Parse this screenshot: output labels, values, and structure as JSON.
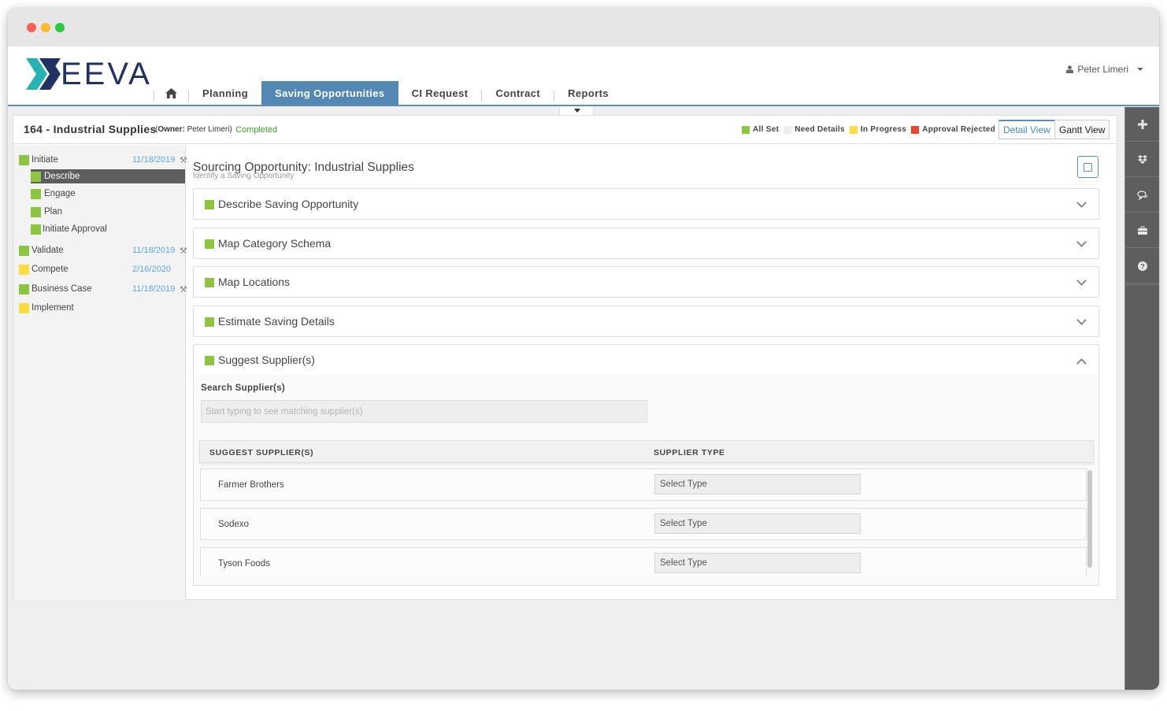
{
  "window": {
    "traffic_lights": [
      "close",
      "minimize",
      "maximize"
    ]
  },
  "brand": {
    "logo_text": "EEVA",
    "logo_mark": "X",
    "name": "XEEVA"
  },
  "nav": {
    "home_icon": "home-icon",
    "items": [
      {
        "label": "Planning",
        "active": false
      },
      {
        "label": "Saving Opportunities",
        "active": true
      },
      {
        "label": "CI Request",
        "active": false
      },
      {
        "label": "Contract",
        "active": false
      },
      {
        "label": "Reports",
        "active": false
      }
    ]
  },
  "user": {
    "name": "Peter Limeri",
    "icon": "user-icon"
  },
  "project": {
    "title": "164 - Industrial Supplies",
    "owner_label": "Owner:",
    "owner_name": "Peter Limeri",
    "status": "Completed"
  },
  "legend": [
    {
      "label": "All Set",
      "color": "#8cc63f"
    },
    {
      "label": "Need Details",
      "color": "#eeeeee"
    },
    {
      "label": "In Progress",
      "color": "#fddc3f"
    },
    {
      "label": "Approval Rejected",
      "color": "#f0452d"
    }
  ],
  "views": {
    "detail": "Detail View",
    "gantt": "Gantt View",
    "active": "Detail View"
  },
  "sidebar": {
    "steps": [
      {
        "label": "Initiate",
        "date": "11/18/2019",
        "status_color": "#8cc63f",
        "has_hammer": true,
        "substeps": [
          {
            "label": "Describe",
            "status_color": "#8cc63f",
            "active": true
          },
          {
            "label": "Engage",
            "status_color": "#8cc63f",
            "active": false
          },
          {
            "label": "Plan",
            "status_color": "#8cc63f",
            "active": false
          },
          {
            "label": "Initiate Approval",
            "status_color": "#8cc63f",
            "active": false
          }
        ]
      },
      {
        "label": "Validate",
        "date": "11/18/2019",
        "status_color": "#8cc63f",
        "has_hammer": true
      },
      {
        "label": "Compete",
        "date": "2/16/2020",
        "status_color": "#fddc3f",
        "has_hammer": false
      },
      {
        "label": "Business Case",
        "date": "11/18/2019",
        "status_color": "#8cc63f",
        "has_hammer": true
      },
      {
        "label": "Implement",
        "date": "",
        "status_color": "#fddc3f",
        "has_hammer": false
      }
    ]
  },
  "main": {
    "title": "Sourcing Opportunity: Industrial Supplies",
    "subtitle": "Identify a Saving Opportunity",
    "panels": [
      {
        "label": "Describe Saving Opportunity",
        "expanded": false
      },
      {
        "label": "Map Category Schema",
        "expanded": false
      },
      {
        "label": "Map Locations",
        "expanded": false
      },
      {
        "label": "Estimate Saving Details",
        "expanded": false
      },
      {
        "label": "Suggest Supplier(s)",
        "expanded": true
      }
    ],
    "supplier_section": {
      "search_label": "Search Supplier(s)",
      "search_placeholder": "Start typing to see matching supplier(s)",
      "search_value": "",
      "columns": [
        "SUGGEST SUPPLIER(S)",
        "SUPPLIER TYPE"
      ],
      "rows": [
        {
          "name": "Farmer Brothers",
          "type": "Select Type"
        },
        {
          "name": "Sodexo",
          "type": "Select Type"
        },
        {
          "name": "Tyson Foods",
          "type": "Select Type"
        }
      ]
    }
  },
  "rightrail": [
    {
      "icon": "plus-icon"
    },
    {
      "icon": "dropbox-icon"
    },
    {
      "icon": "comments-icon"
    },
    {
      "icon": "briefcase-icon"
    },
    {
      "icon": "help-icon"
    }
  ]
}
